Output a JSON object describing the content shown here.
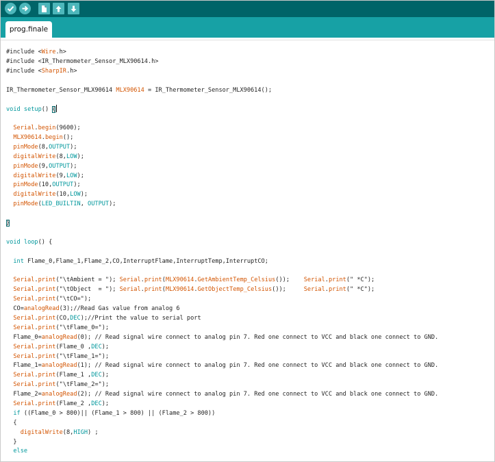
{
  "toolbar": {
    "buttons": [
      {
        "name": "verify",
        "icon": "check-icon"
      },
      {
        "name": "upload",
        "icon": "arrow-right-icon"
      },
      {
        "name": "new",
        "icon": "new-file-icon"
      },
      {
        "name": "open",
        "icon": "arrow-up-icon"
      },
      {
        "name": "save",
        "icon": "arrow-down-icon"
      }
    ]
  },
  "tab": {
    "label": "prog.finale"
  },
  "colors": {
    "toolbar": "#006468",
    "tabbar": "#17a1a5",
    "keyword": "#00979c",
    "function": "#d35400"
  },
  "code_lines": [
    [
      {
        "t": "#include <"
      },
      {
        "t": "Wire",
        "c": "fn"
      },
      {
        "t": ".h>"
      }
    ],
    [
      {
        "t": "#include <IR_Thermometer_Sensor_MLX90614.h>"
      }
    ],
    [
      {
        "t": "#include <"
      },
      {
        "t": "SharpIR",
        "c": "fn"
      },
      {
        "t": ".h>"
      }
    ],
    [],
    [
      {
        "t": "IR_Thermometer_Sensor_MLX90614 "
      },
      {
        "t": "MLX90614",
        "c": "fn"
      },
      {
        "t": " = IR_Thermometer_Sensor_MLX90614();"
      }
    ],
    [],
    [
      {
        "t": "void",
        "c": "kw"
      },
      {
        "t": " "
      },
      {
        "t": "setup",
        "c": "kw"
      },
      {
        "t": "() "
      },
      {
        "t": "{",
        "c": "box"
      }
    ],
    [],
    [
      {
        "t": "  "
      },
      {
        "t": "Serial",
        "c": "fn"
      },
      {
        "t": "."
      },
      {
        "t": "begin",
        "c": "fn"
      },
      {
        "t": "(9600);"
      }
    ],
    [
      {
        "t": "  "
      },
      {
        "t": "MLX90614",
        "c": "fn"
      },
      {
        "t": "."
      },
      {
        "t": "begin",
        "c": "fn"
      },
      {
        "t": "();"
      }
    ],
    [
      {
        "t": "  "
      },
      {
        "t": "pinMode",
        "c": "fn"
      },
      {
        "t": "(8,"
      },
      {
        "t": "OUTPUT",
        "c": "kw"
      },
      {
        "t": ");"
      }
    ],
    [
      {
        "t": "  "
      },
      {
        "t": "digitalWrite",
        "c": "fn"
      },
      {
        "t": "(8,"
      },
      {
        "t": "LOW",
        "c": "kw"
      },
      {
        "t": ");"
      }
    ],
    [
      {
        "t": "  "
      },
      {
        "t": "pinMode",
        "c": "fn"
      },
      {
        "t": "(9,"
      },
      {
        "t": "OUTPUT",
        "c": "kw"
      },
      {
        "t": ");"
      }
    ],
    [
      {
        "t": "  "
      },
      {
        "t": "digitalWrite",
        "c": "fn"
      },
      {
        "t": "(9,"
      },
      {
        "t": "LOW",
        "c": "kw"
      },
      {
        "t": ");"
      }
    ],
    [
      {
        "t": "  "
      },
      {
        "t": "pinMode",
        "c": "fn"
      },
      {
        "t": "(10,"
      },
      {
        "t": "OUTPUT",
        "c": "kw"
      },
      {
        "t": ");"
      }
    ],
    [
      {
        "t": "  "
      },
      {
        "t": "digitalWrite",
        "c": "fn"
      },
      {
        "t": "(10,"
      },
      {
        "t": "LOW",
        "c": "kw"
      },
      {
        "t": ");"
      }
    ],
    [
      {
        "t": "  "
      },
      {
        "t": "pinMode",
        "c": "fn"
      },
      {
        "t": "("
      },
      {
        "t": "LED_BUILTIN",
        "c": "kw"
      },
      {
        "t": ", "
      },
      {
        "t": "OUTPUT",
        "c": "kw"
      },
      {
        "t": ");"
      }
    ],
    [],
    [
      {
        "t": "}",
        "c": "box"
      }
    ],
    [],
    [
      {
        "t": "void",
        "c": "kw"
      },
      {
        "t": " "
      },
      {
        "t": "loop",
        "c": "kw"
      },
      {
        "t": "() {"
      }
    ],
    [],
    [
      {
        "t": "  "
      },
      {
        "t": "int",
        "c": "kw"
      },
      {
        "t": " Flame_0,Flame_1,Flame_2,CO,InterruptFlame,InterruptTemp,InterruptCO;"
      }
    ],
    [],
    [
      {
        "t": "  "
      },
      {
        "t": "Serial",
        "c": "fn"
      },
      {
        "t": "."
      },
      {
        "t": "print",
        "c": "fn"
      },
      {
        "t": "(\"\\tAmbient = \"); "
      },
      {
        "t": "Serial",
        "c": "fn"
      },
      {
        "t": "."
      },
      {
        "t": "print",
        "c": "fn"
      },
      {
        "t": "("
      },
      {
        "t": "MLX90614",
        "c": "fn"
      },
      {
        "t": "."
      },
      {
        "t": "GetAmbientTemp_Celsius",
        "c": "fn"
      },
      {
        "t": "());    "
      },
      {
        "t": "Serial",
        "c": "fn"
      },
      {
        "t": "."
      },
      {
        "t": "print",
        "c": "fn"
      },
      {
        "t": "(\" *C\");"
      }
    ],
    [
      {
        "t": "  "
      },
      {
        "t": "Serial",
        "c": "fn"
      },
      {
        "t": "."
      },
      {
        "t": "print",
        "c": "fn"
      },
      {
        "t": "(\"\\tObject  = \"); "
      },
      {
        "t": "Serial",
        "c": "fn"
      },
      {
        "t": "."
      },
      {
        "t": "print",
        "c": "fn"
      },
      {
        "t": "("
      },
      {
        "t": "MLX90614",
        "c": "fn"
      },
      {
        "t": "."
      },
      {
        "t": "GetObjectTemp_Celsius",
        "c": "fn"
      },
      {
        "t": "());     "
      },
      {
        "t": "Serial",
        "c": "fn"
      },
      {
        "t": "."
      },
      {
        "t": "print",
        "c": "fn"
      },
      {
        "t": "(\" *C\");"
      }
    ],
    [
      {
        "t": "  "
      },
      {
        "t": "Serial",
        "c": "fn"
      },
      {
        "t": "."
      },
      {
        "t": "print",
        "c": "fn"
      },
      {
        "t": "(\"\\tCO=\");"
      }
    ],
    [
      {
        "t": "  CO="
      },
      {
        "t": "analogRead",
        "c": "fn"
      },
      {
        "t": "(3);//Read Gas value from analog 6"
      }
    ],
    [
      {
        "t": "  "
      },
      {
        "t": "Serial",
        "c": "fn"
      },
      {
        "t": "."
      },
      {
        "t": "print",
        "c": "fn"
      },
      {
        "t": "(CO,"
      },
      {
        "t": "DEC",
        "c": "kw"
      },
      {
        "t": ");//Print the value to serial port"
      }
    ],
    [
      {
        "t": "  "
      },
      {
        "t": "Serial",
        "c": "fn"
      },
      {
        "t": "."
      },
      {
        "t": "print",
        "c": "fn"
      },
      {
        "t": "(\"\\tFlame_0=\");"
      }
    ],
    [
      {
        "t": "  Flame_0="
      },
      {
        "t": "analogRead",
        "c": "fn"
      },
      {
        "t": "(0); // Read signal wire connect to analog pin 7. Red one connect to VCC and black one connect to GND."
      }
    ],
    [
      {
        "t": "  "
      },
      {
        "t": "Serial",
        "c": "fn"
      },
      {
        "t": "."
      },
      {
        "t": "print",
        "c": "fn"
      },
      {
        "t": "(Flame_0 ,"
      },
      {
        "t": "DEC",
        "c": "kw"
      },
      {
        "t": ");"
      }
    ],
    [
      {
        "t": "  "
      },
      {
        "t": "Serial",
        "c": "fn"
      },
      {
        "t": "."
      },
      {
        "t": "print",
        "c": "fn"
      },
      {
        "t": "(\"\\tFlame_1=\");"
      }
    ],
    [
      {
        "t": "  Flame_1="
      },
      {
        "t": "analogRead",
        "c": "fn"
      },
      {
        "t": "(1); // Read signal wire connect to analog pin 7. Red one connect to VCC and black one connect to GND."
      }
    ],
    [
      {
        "t": "  "
      },
      {
        "t": "Serial",
        "c": "fn"
      },
      {
        "t": "."
      },
      {
        "t": "print",
        "c": "fn"
      },
      {
        "t": "(Flame_1 ,"
      },
      {
        "t": "DEC",
        "c": "kw"
      },
      {
        "t": ");"
      }
    ],
    [
      {
        "t": "  "
      },
      {
        "t": "Serial",
        "c": "fn"
      },
      {
        "t": "."
      },
      {
        "t": "print",
        "c": "fn"
      },
      {
        "t": "(\"\\tFlame_2=\");"
      }
    ],
    [
      {
        "t": "  Flame_2="
      },
      {
        "t": "analogRead",
        "c": "fn"
      },
      {
        "t": "(2); // Read signal wire connect to analog pin 7. Red one connect to VCC and black one connect to GND."
      }
    ],
    [
      {
        "t": "  "
      },
      {
        "t": "Serial",
        "c": "fn"
      },
      {
        "t": "."
      },
      {
        "t": "print",
        "c": "fn"
      },
      {
        "t": "(Flame_2 ,"
      },
      {
        "t": "DEC",
        "c": "kw"
      },
      {
        "t": ");"
      }
    ],
    [
      {
        "t": "  "
      },
      {
        "t": "if",
        "c": "kw"
      },
      {
        "t": " ((Flame_0 > 800)|| (Flame_1 > 800) || (Flame_2 > 800))"
      }
    ],
    [
      {
        "t": "  {"
      }
    ],
    [
      {
        "t": "    "
      },
      {
        "t": "digitalWrite",
        "c": "fn"
      },
      {
        "t": "(8,"
      },
      {
        "t": "HIGH",
        "c": "kw"
      },
      {
        "t": ") ;"
      }
    ],
    [
      {
        "t": "  }"
      }
    ],
    [
      {
        "t": "  "
      },
      {
        "t": "else",
        "c": "kw"
      }
    ]
  ]
}
